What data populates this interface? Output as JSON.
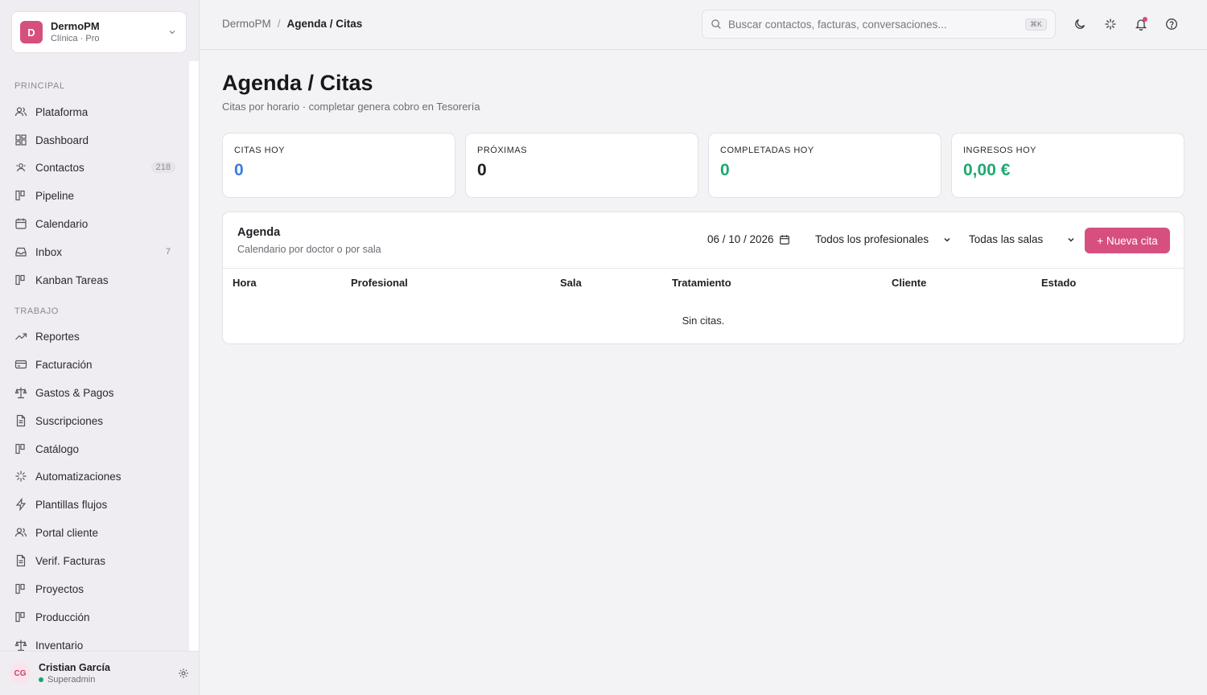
{
  "org": {
    "initial": "D",
    "name": "DermoPM",
    "plan": "Clínica · Pro"
  },
  "sidebar": {
    "sections": [
      {
        "label": "PRINCIPAL",
        "items": [
          {
            "label": "Plataforma",
            "icon": "users-icon"
          },
          {
            "label": "Dashboard",
            "icon": "dashboard-icon"
          },
          {
            "label": "Contactos",
            "icon": "contacts-icon",
            "count": "218"
          },
          {
            "label": "Pipeline",
            "icon": "pipeline-icon"
          },
          {
            "label": "Calendario",
            "icon": "calendar-icon"
          },
          {
            "label": "Inbox",
            "icon": "inbox-icon",
            "count": "7"
          },
          {
            "label": "Kanban Tareas",
            "icon": "kanban-icon"
          }
        ]
      },
      {
        "label": "TRABAJO",
        "items": [
          {
            "label": "Reportes",
            "icon": "trending-icon"
          },
          {
            "label": "Facturación",
            "icon": "card-icon"
          },
          {
            "label": "Gastos & Pagos",
            "icon": "scale-icon"
          },
          {
            "label": "Suscripciones",
            "icon": "document-icon"
          },
          {
            "label": "Catálogo",
            "icon": "kanban-icon"
          },
          {
            "label": "Automatizaciones",
            "icon": "sparkle-icon"
          },
          {
            "label": "Plantillas flujos",
            "icon": "bolt-icon"
          },
          {
            "label": "Portal cliente",
            "icon": "users-icon"
          },
          {
            "label": "Verif. Facturas",
            "icon": "document-icon"
          },
          {
            "label": "Proyectos",
            "icon": "kanban-icon"
          },
          {
            "label": "Producción",
            "icon": "kanban-icon"
          },
          {
            "label": "Inventario",
            "icon": "scale-icon"
          }
        ]
      }
    ]
  },
  "user": {
    "initials": "CG",
    "name": "Cristian García",
    "role": "Superadmin"
  },
  "header": {
    "breadcrumb_root": "DermoPM",
    "breadcrumb_sep": "/",
    "breadcrumb_current": "Agenda / Citas",
    "search_placeholder": "Buscar contactos, facturas, conversaciones...",
    "search_shortcut": "⌘K"
  },
  "page": {
    "title": "Agenda / Citas",
    "subtitle": "Citas por horario · completar genera cobro en Tesorería"
  },
  "stats": [
    {
      "label": "CITAS HOY",
      "value": "0",
      "color": "#3b7ddd"
    },
    {
      "label": "PRÓXIMAS",
      "value": "0",
      "color": "#1f1f24"
    },
    {
      "label": "COMPLETADAS HOY",
      "value": "0",
      "color": "#1fa971"
    },
    {
      "label": "INGRESOS HOY",
      "value": "0,00 €",
      "color": "#1fa971"
    }
  ],
  "agenda": {
    "title": "Agenda",
    "subtitle": "Calendario por doctor o por sala",
    "date": "06 / 10 / 2026",
    "professional_select": "Todos los profesionales",
    "room_select": "Todas las salas",
    "new_button": "+ Nueva cita",
    "columns": [
      "Hora",
      "Profesional",
      "Sala",
      "Tratamiento",
      "Cliente",
      "Estado"
    ],
    "empty_text": "Sin citas."
  },
  "colors": {
    "accent": "#d64f7f",
    "blue": "#3b7ddd",
    "green": "#1fa971"
  }
}
